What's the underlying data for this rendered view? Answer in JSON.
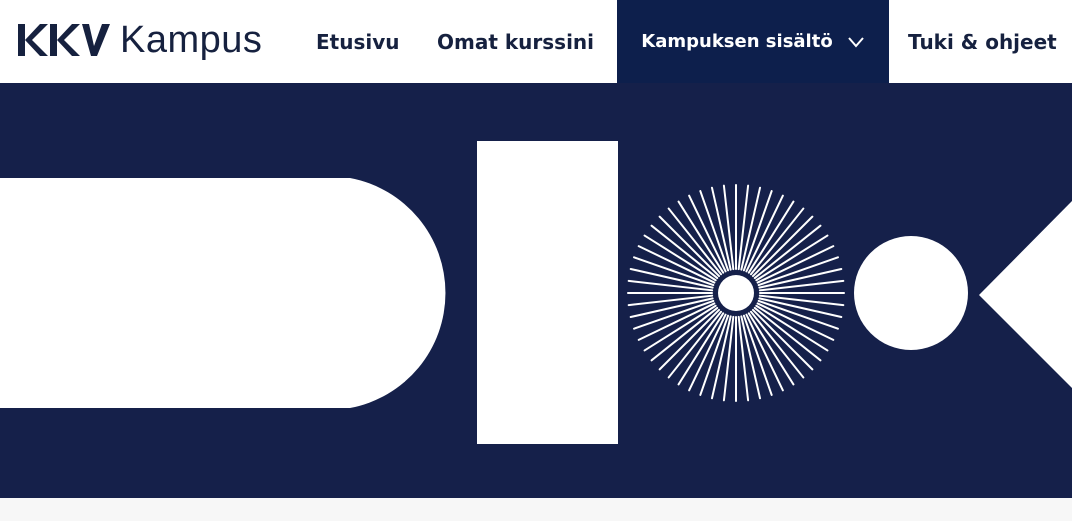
{
  "logo": {
    "text": "Kampus",
    "mark_letters": "KKV",
    "icon": "kkv-logo-icon"
  },
  "nav": {
    "home_label": "Etusivu",
    "courses_label": "Omat kurssini",
    "content_label": "Kampuksen sisältö",
    "content_icon": "chevron-down-icon",
    "help_label": "Tuki & ohjeet"
  },
  "colors": {
    "brand_navy": "#15204a",
    "active_nav_bg": "#0d1f4c",
    "text_dark": "#16213f",
    "shape_white": "#ffffff"
  },
  "hero": {
    "shapes": [
      "rounded-bar",
      "rectangle",
      "starburst",
      "circle",
      "chevron"
    ]
  }
}
